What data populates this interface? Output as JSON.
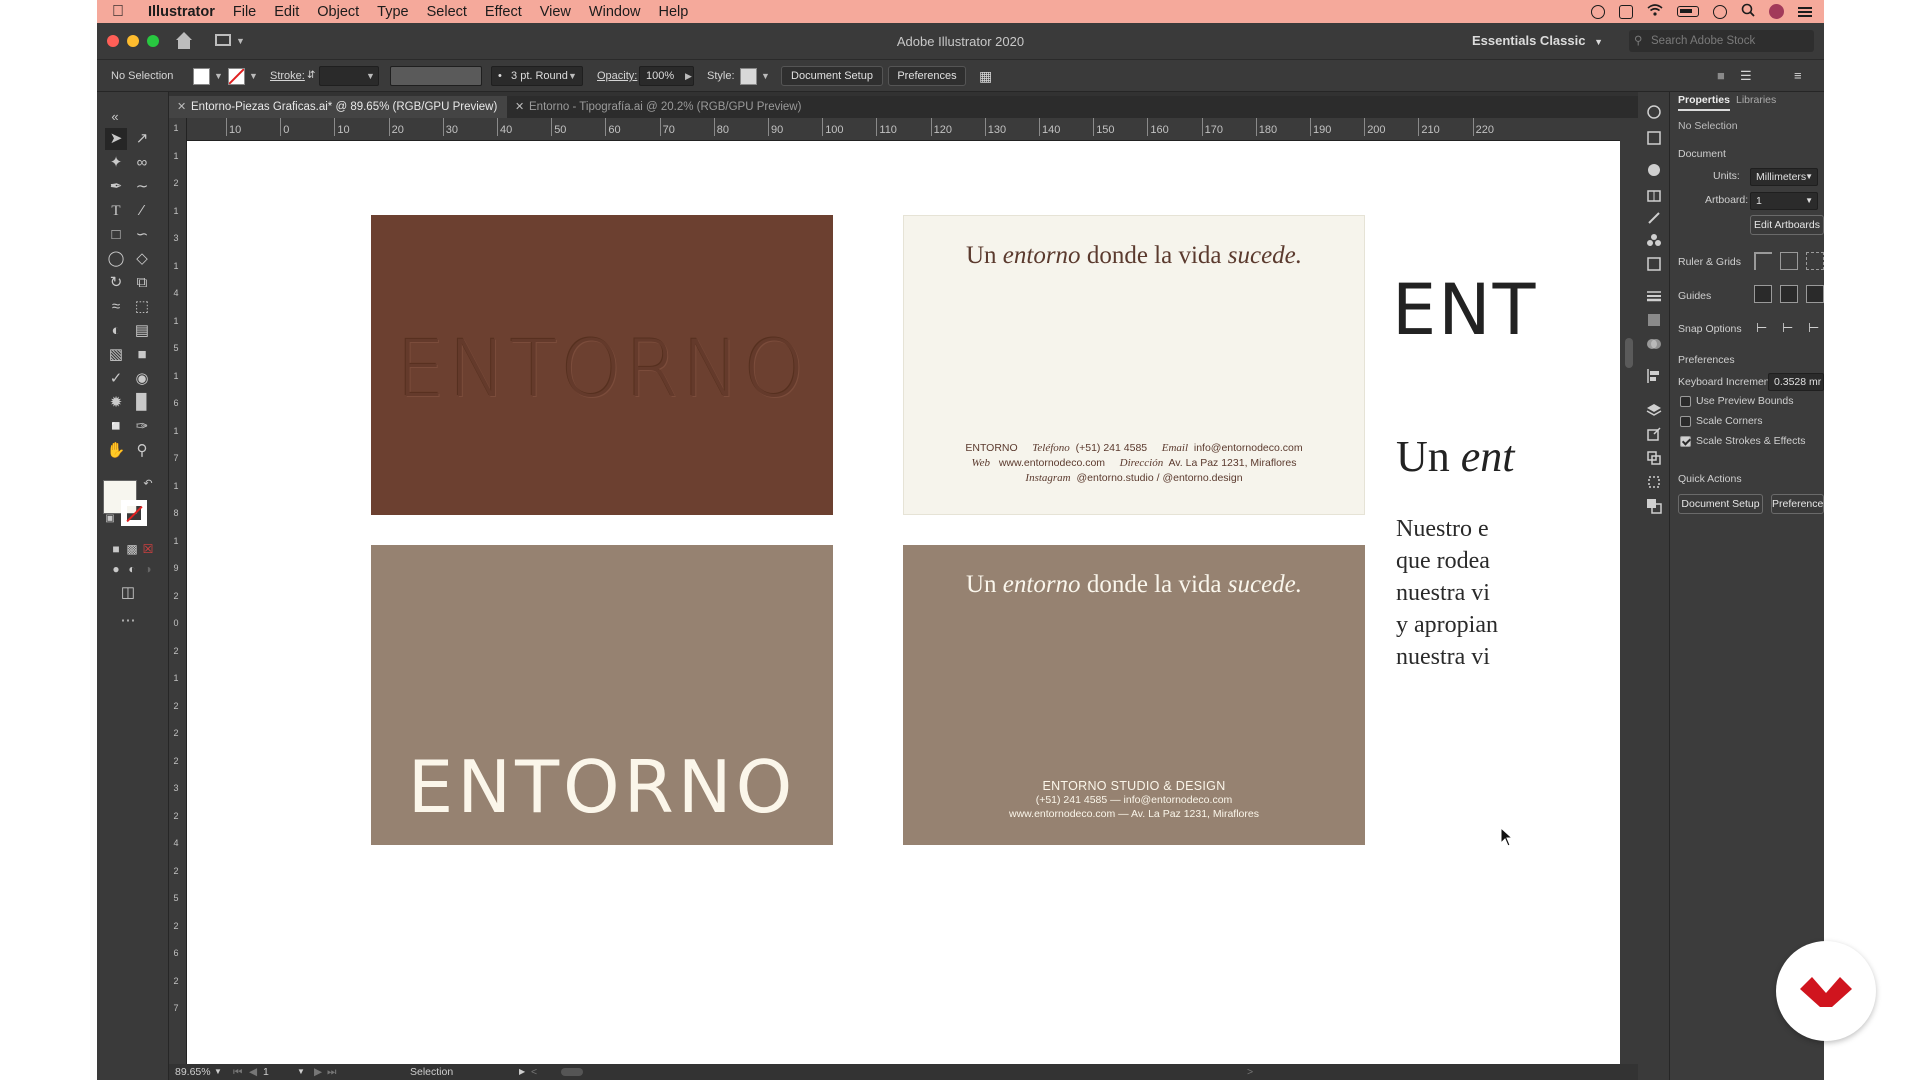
{
  "menubar": {
    "app_name": "Illustrator",
    "items": [
      "File",
      "Edit",
      "Object",
      "Type",
      "Select",
      "Effect",
      "View",
      "Window",
      "Help"
    ]
  },
  "appbar": {
    "title": "Adobe Illustrator 2020",
    "workspace": "Essentials Classic",
    "search_placeholder": "Search Adobe Stock"
  },
  "control": {
    "selection": "No Selection",
    "stroke_label": "Stroke:",
    "brush": "3 pt. Round",
    "opacity_label": "Opacity:",
    "opacity_value": "100%",
    "style_label": "Style:",
    "doc_setup": "Document Setup",
    "preferences": "Preferences"
  },
  "tabs": [
    {
      "label": "Entorno-Piezas Graficas.ai* @ 89.65% (RGB/GPU Preview)",
      "active": true
    },
    {
      "label": "Entorno - Tipografía.ai @ 20.2% (RGB/GPU Preview)",
      "active": false
    }
  ],
  "ruler_top": [
    "10",
    "0",
    "10",
    "20",
    "30",
    "40",
    "50",
    "60",
    "70",
    "80",
    "90",
    "100",
    "110",
    "120",
    "130",
    "140",
    "150",
    "160",
    "170",
    "180",
    "190",
    "200",
    "210",
    "220"
  ],
  "ruler_left": [
    "1",
    "1",
    "2",
    "1",
    "3",
    "1",
    "4",
    "1",
    "5",
    "1",
    "6",
    "1",
    "7",
    "1",
    "8",
    "1",
    "9",
    "2",
    "0",
    "2",
    "1",
    "2",
    "2",
    "2",
    "3",
    "2",
    "4",
    "2",
    "5",
    "2",
    "6",
    "2",
    "7"
  ],
  "cards": {
    "brand": "ENTORNO",
    "tagline_pre": "Un ",
    "tagline_em1": "entorno",
    "tagline_mid": " donde la vida ",
    "tagline_em2": "sucede.",
    "card2": {
      "line1_name": "ENTORNO",
      "tel_label": "Teléfono",
      "tel": "(+51) 241 4585",
      "email_label": "Email",
      "email": "info@entornodeco.com",
      "web_label": "Web",
      "web": "www.entornodeco.com",
      "addr_label": "Dirección",
      "addr": "Av. La Paz 1231, Miraflores",
      "ig_label": "Instagram",
      "ig": "@entorno.studio / @entorno.design"
    },
    "card4": {
      "name": "ENTORNO STUDIO & DESIGN",
      "line2": "(+51) 241 4585 — info@entornodeco.com",
      "line3": "www.entornodeco.com — Av. La Paz 1231, Miraflores"
    }
  },
  "artboard_right": {
    "big_word": "ENT",
    "tag_plain": "Un ",
    "tag_em": "ent",
    "para": [
      "Nuestro e",
      "que rodea",
      "nuestra vi",
      "y apropian",
      "nuestra vi"
    ]
  },
  "status": {
    "zoom": "89.65%",
    "artboard": "1",
    "tool": "Selection"
  },
  "properties": {
    "tab_properties": "Properties",
    "tab_libraries": "Libraries",
    "no_selection": "No Selection",
    "document": "Document",
    "units_label": "Units:",
    "units_value": "Millimeters",
    "artboard_label": "Artboard:",
    "artboard_value": "1",
    "edit_artboards": "Edit Artboards",
    "ruler_grids": "Ruler & Grids",
    "guides": "Guides",
    "snap_options": "Snap Options",
    "preferences": "Preferences",
    "kb_label": "Keyboard Increment:",
    "kb_value": "0.3528 mr",
    "use_preview_bounds": "Use Preview Bounds",
    "scale_corners": "Scale Corners",
    "scale_strokes": "Scale Strokes & Effects",
    "quick_actions": "Quick Actions",
    "qa_doc_setup": "Document Setup",
    "qa_preferences": "Preferences"
  },
  "colors": {
    "menubar": "#f5a99b",
    "card_brown": "#6c4030",
    "card_cream": "#f6f4ec",
    "card_taupe": "#968271",
    "badge_red": "#d0141e"
  }
}
